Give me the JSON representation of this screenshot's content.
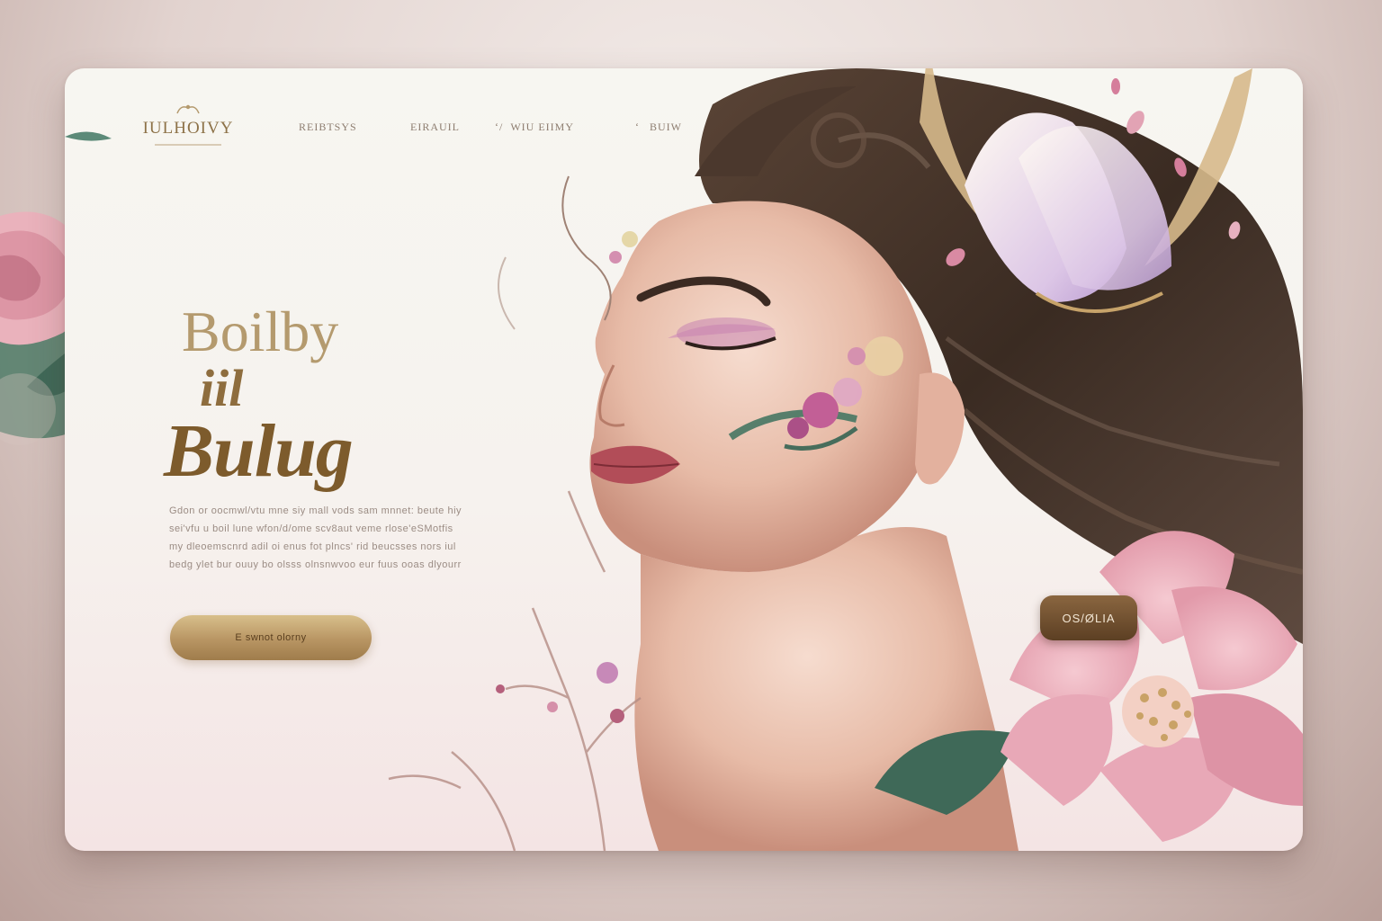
{
  "brand": {
    "logo_text": "IULHOIVY"
  },
  "nav": {
    "items": [
      {
        "label": "REIBTSYS"
      },
      {
        "label": "EIRAUIL"
      },
      {
        "label": "WIU EIIMY"
      },
      {
        "label": "BUIW"
      }
    ]
  },
  "hero": {
    "headline_line1": "Boilby",
    "headline_line2": "iil",
    "headline_line3": "Bulug",
    "body_lines": [
      "Gdon or oocmwl/vtu mne siy mall vods sam mnnet: beute hiy",
      "sei'vfu u boil lune wfon/d/ome scv8aut veme rlose'eSMotfis",
      "my dleoemscnrd adil oi enus fot plncs' rid beucsses nors iul",
      "bedg ylet bur ouuy bo olsss olnsnwvoo eur fuus ooas dlyourr"
    ],
    "cta_label": "E swnot olorny"
  },
  "overlay_button": {
    "label": "OS/ØLIA"
  },
  "colors": {
    "gold_text": "#b49a6e",
    "gold_dark": "#7d5b2c",
    "button_gold": "#c2a06b",
    "button_brown": "#6e4e2e",
    "rose": "#e9a8b5",
    "leaf": "#4f7b67",
    "hair": "#3a2b22"
  }
}
